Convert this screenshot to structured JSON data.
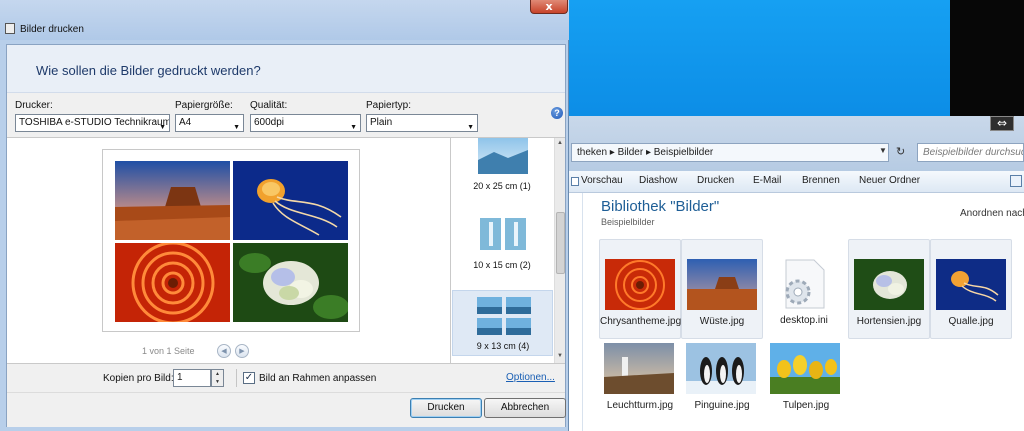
{
  "dialog": {
    "title": "Bilder drucken",
    "close_label": "x",
    "heading": "Wie sollen die Bilder gedruckt werden?",
    "printer": {
      "label": "Drucker:",
      "value": "TOSHIBA e-STUDIO Technikraum"
    },
    "paper_size": {
      "label": "Papiergröße:",
      "value": "A4"
    },
    "quality": {
      "label": "Qualität:",
      "value": "600dpi"
    },
    "paper_type": {
      "label": "Papiertyp:",
      "value": "Plain"
    },
    "help_label": "?",
    "preview_images": [
      "desert-mesa",
      "jellyfish",
      "chrysanthemum",
      "hydrangea"
    ],
    "pager": {
      "text": "1 von 1 Seite",
      "prev": "◀",
      "next": "▶"
    },
    "layouts": [
      {
        "label": "20 x 25 cm (1)"
      },
      {
        "label": "10 x 15 cm (2)"
      },
      {
        "label": "9 x 13 cm (4)",
        "selected": true
      }
    ],
    "copies": {
      "label": "Kopien pro Bild:",
      "value": "1"
    },
    "fit_frame": {
      "label": "Bild an Rahmen anpassen",
      "checked": true,
      "mark": "✓"
    },
    "options_link": "Optionen...",
    "print_button": "Drucken",
    "cancel_button": "Abbrechen"
  },
  "explorer": {
    "address": "theken  ▸  Bilder  ▸  Beispielbilder",
    "search_placeholder": "Beispielbilder durchsuchen",
    "toolbar": [
      "Vorschau",
      "Diashow",
      "Drucken",
      "E-Mail",
      "Brennen",
      "Neuer Ordner"
    ],
    "library_title": "Bibliothek \"Bilder\"",
    "library_subtitle": "Beispielbilder",
    "arrange_label": "Anordnen nach",
    "files": [
      {
        "name": "Chrysantheme.jpg",
        "thumb": "chrysanthemum",
        "selected": true
      },
      {
        "name": "Wüste.jpg",
        "thumb": "desert-mesa",
        "selected": true
      },
      {
        "name": "desktop.ini",
        "thumb": "settings-file-icon",
        "selected": false
      },
      {
        "name": "Hortensien.jpg",
        "thumb": "hydrangea",
        "selected": true
      },
      {
        "name": "Qualle.jpg",
        "thumb": "jellyfish",
        "selected": true
      },
      {
        "name": "Leuchtturm.jpg",
        "thumb": "lighthouse",
        "selected": false
      },
      {
        "name": "Pinguine.jpg",
        "thumb": "penguins",
        "selected": false
      },
      {
        "name": "Tulpen.jpg",
        "thumb": "tulips",
        "selected": false
      }
    ]
  },
  "colors": {
    "desktop": "#0a8fe8",
    "library_title": "#1e5e96",
    "link": "#1a5fb4"
  }
}
